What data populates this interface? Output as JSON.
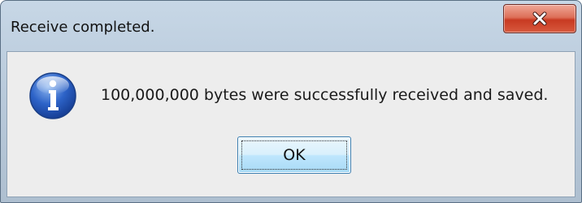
{
  "window": {
    "title": "Receive completed.",
    "close_icon": "close-icon"
  },
  "dialog": {
    "icon": "info-icon",
    "message": "100,000,000 bytes were successfully received and saved.",
    "ok_label": "OK"
  }
}
